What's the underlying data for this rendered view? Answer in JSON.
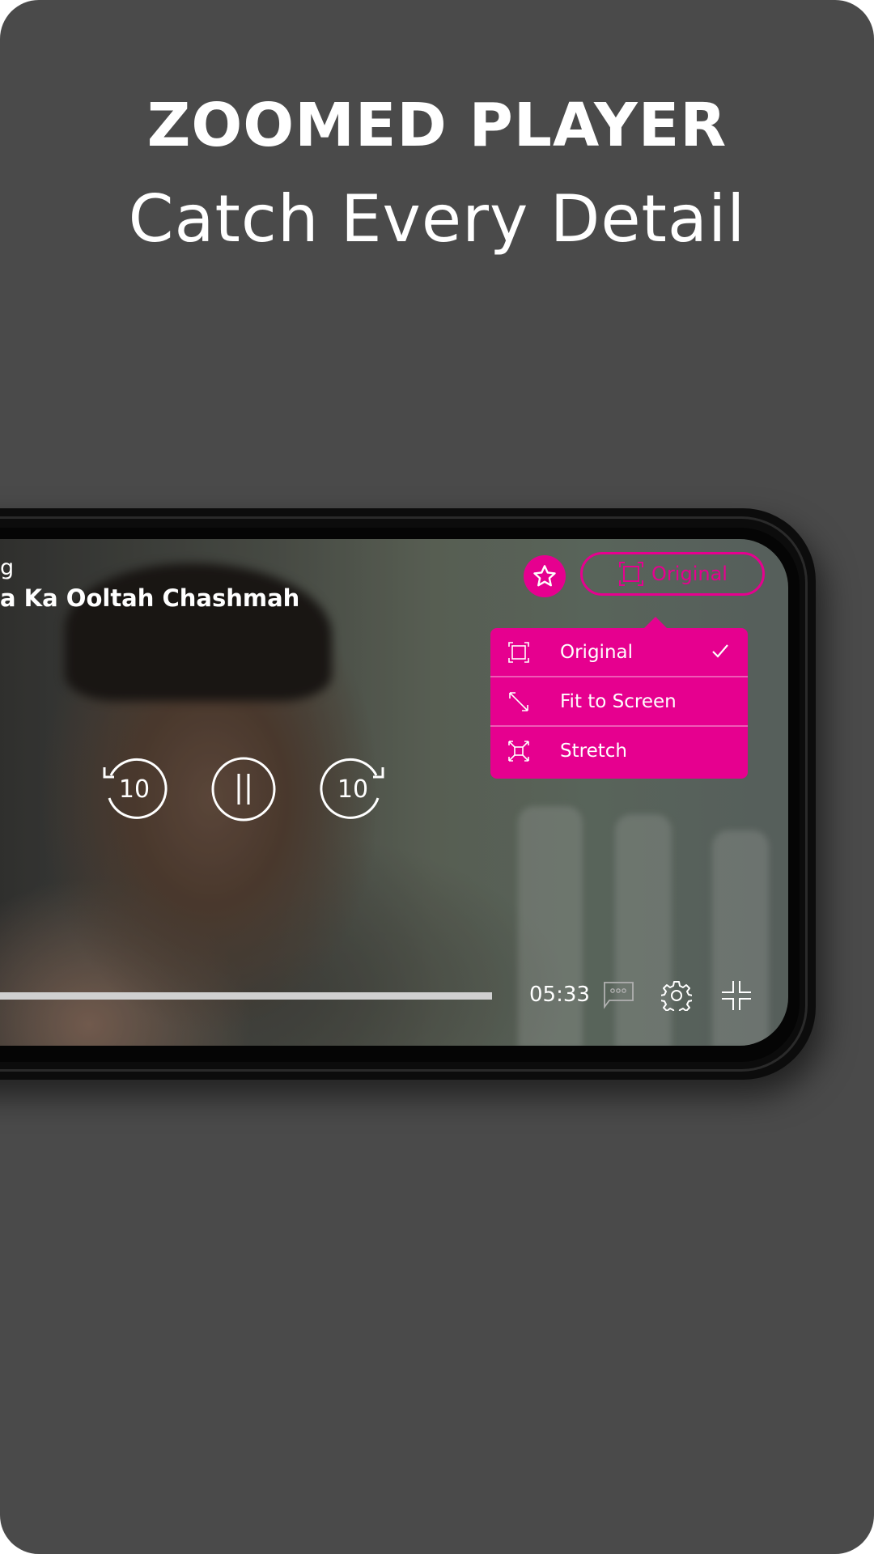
{
  "promo": {
    "headline": "ZOOMED PLAYER",
    "subline": "Catch Every Detail"
  },
  "player": {
    "now_playing_label": "g",
    "show_title": "a Ka Ooltah Chashmah",
    "favorite_icon": "star-icon",
    "aspect_button": {
      "icon": "aspect-original-icon",
      "label": "Original"
    },
    "aspect_menu": {
      "items": [
        {
          "icon": "aspect-original-icon",
          "label": "Original",
          "selected": true
        },
        {
          "icon": "fit-to-screen-icon",
          "label": "Fit to Screen",
          "selected": false
        },
        {
          "icon": "stretch-icon",
          "label": "Stretch",
          "selected": false
        }
      ],
      "selected_icon": "checkmark-icon"
    },
    "controls": {
      "rewind_seconds": "10",
      "forward_seconds": "10",
      "play_state": "playing"
    },
    "remaining_time": "05:33",
    "bottom_icons": [
      "subtitles-icon",
      "settings-gear-icon",
      "exit-fullscreen-icon"
    ]
  },
  "colors": {
    "accent": "#e6008f",
    "background": "#4a4a4a",
    "text": "#ffffff"
  }
}
